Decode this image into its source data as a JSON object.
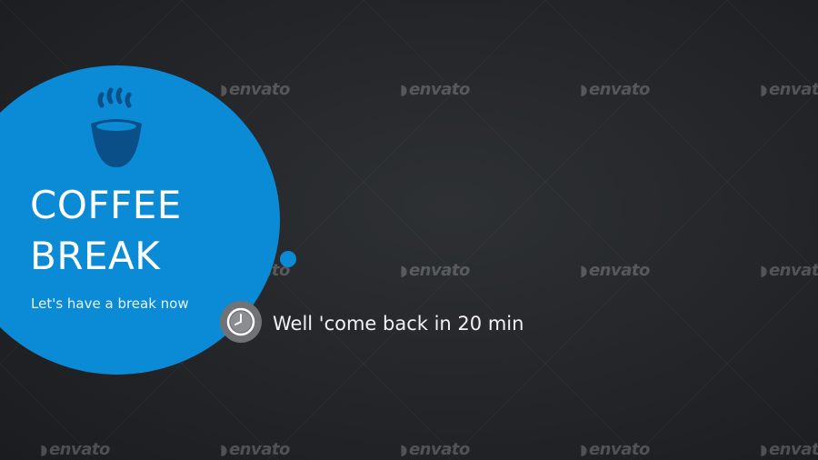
{
  "slide": {
    "title_line1": "COFFEE",
    "title_line2": "BREAK",
    "subtitle": "Let's have a break now",
    "message": "Well 'come back in 20 min"
  },
  "icons": {
    "cup": "coffee-cup-icon",
    "clock": "clock-icon"
  },
  "watermark": {
    "text": "envato"
  },
  "colors": {
    "background": "#232528",
    "accent": "#0b8ad6",
    "cup": "#0a4f87",
    "badge": "#6f7378",
    "text": "#ffffff"
  }
}
